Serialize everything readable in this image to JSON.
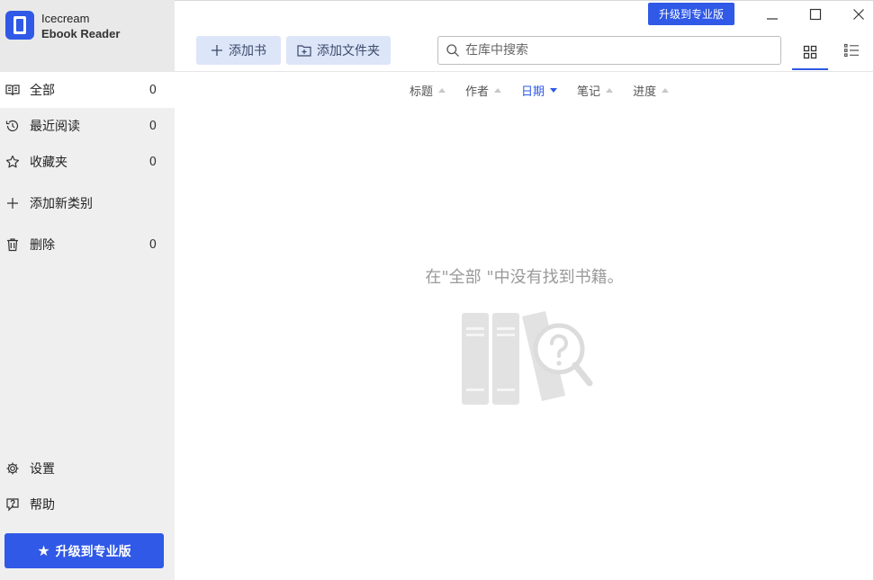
{
  "app": {
    "name_line1": "Icecream",
    "name_line2": "Ebook Reader"
  },
  "sidebar": {
    "items": [
      {
        "label": "全部",
        "count": "0",
        "icon": "book-open-icon",
        "active": true
      },
      {
        "label": "最近阅读",
        "count": "0",
        "icon": "history-icon"
      },
      {
        "label": "收藏夹",
        "count": "0",
        "icon": "star-outline-icon"
      },
      {
        "label": "添加新类别",
        "count": "",
        "icon": "plus-icon"
      },
      {
        "label": "删除",
        "count": "0",
        "icon": "trash-icon"
      }
    ],
    "bottom": [
      {
        "label": "设置",
        "icon": "gear-icon"
      },
      {
        "label": "帮助",
        "icon": "help-icon"
      }
    ],
    "upgrade_label": "升级到专业版"
  },
  "toolbar": {
    "upgrade_label": "升级到专业版",
    "add_book_label": "添加书",
    "add_folder_label": "添加文件夹",
    "search_placeholder": "在库中搜索"
  },
  "sort": {
    "columns": [
      {
        "label": "标题",
        "active": false
      },
      {
        "label": "作者",
        "active": false
      },
      {
        "label": "日期",
        "active": true
      },
      {
        "label": "笔记",
        "active": false
      },
      {
        "label": "进度",
        "active": false
      }
    ]
  },
  "empty": {
    "message": "在\"全部 \"中没有找到书籍。"
  },
  "colors": {
    "accent": "#2f59e6",
    "sidebar_bg": "#efefef",
    "button_bg": "#dde5f8"
  }
}
